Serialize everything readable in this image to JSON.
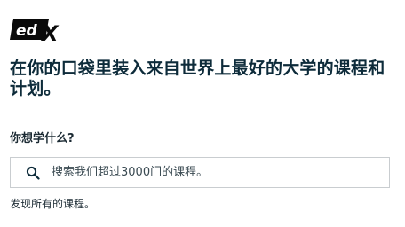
{
  "brand": {
    "logo_text": "edX",
    "logo_icon": "edx-logo-icon",
    "text_color": "#0d2b3a"
  },
  "hero": {
    "headline": "在你的口袋里装入来自世界上最好的大学的课程和计划。"
  },
  "search": {
    "question": "你想学什么?",
    "placeholder": "搜索我们超过3000门的课程。",
    "value": "",
    "icon": "search-icon",
    "border_color": "#c9cdd0"
  },
  "links": {
    "discover_all": "发现所有的课程。"
  }
}
